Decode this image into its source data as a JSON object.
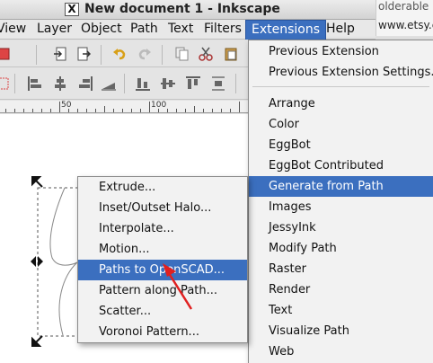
{
  "window": {
    "title": "New document 1 - Inkscape",
    "x_logo": "X"
  },
  "background_peek": {
    "line1": "olderable",
    "line2": "www.etsy.c"
  },
  "menubar": {
    "items": [
      "View",
      "Layer",
      "Object",
      "Path",
      "Text",
      "Filters",
      "Extensions",
      "Help"
    ],
    "active": "Extensions"
  },
  "ruler": {
    "labels": [
      "50",
      "100"
    ]
  },
  "extensions_menu": {
    "top_items": [
      "Previous Extension",
      "Previous Extension Settings..."
    ],
    "items": [
      "Arrange",
      "Color",
      "EggBot",
      "EggBot Contributed",
      "Generate from Path",
      "Images",
      "JessyInk",
      "Modify Path",
      "Raster",
      "Render",
      "Text",
      "Visualize Path",
      "Web"
    ],
    "highlighted": "Generate from Path"
  },
  "submenu": {
    "items": [
      "Extrude...",
      "Inset/Outset Halo...",
      "Interpolate...",
      "Motion...",
      "Paths to OpenSCAD...",
      "Pattern along Path...",
      "Scatter...",
      "Voronoi Pattern..."
    ],
    "highlighted": "Paths to OpenSCAD..."
  },
  "colors": {
    "highlight": "#3b6fbf",
    "annotation_arrow": "#e02020"
  },
  "icons": {
    "toolbar_row1": [
      "save-icon",
      "import-icon",
      "export-icon",
      "undo-icon",
      "redo-icon",
      "duplicate-icon",
      "cut-icon",
      "paste-icon"
    ],
    "toolbar_row2": [
      "align-left-icon",
      "align-center-icon",
      "align-right-icon",
      "distribute-icon",
      "align-bottom-icon",
      "align-middle-icon",
      "align-top-icon",
      "distribute-vertical-icon"
    ]
  }
}
